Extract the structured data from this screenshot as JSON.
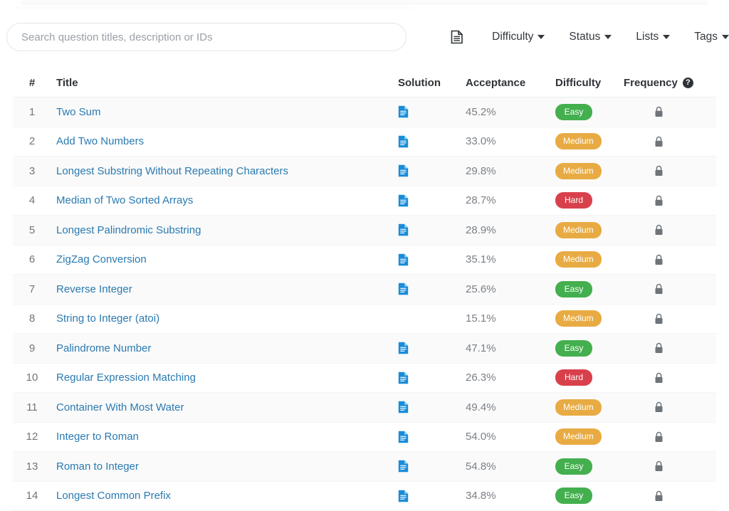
{
  "search": {
    "placeholder": "Search question titles, description or IDs",
    "value": ""
  },
  "toolbar": {
    "doc_icon": "document-icon",
    "filters": [
      {
        "label": "Difficulty"
      },
      {
        "label": "Status"
      },
      {
        "label": "Lists"
      },
      {
        "label": "Tags"
      }
    ]
  },
  "table": {
    "columns": {
      "number": "#",
      "title": "Title",
      "solution": "Solution",
      "acceptance": "Acceptance",
      "difficulty": "Difficulty",
      "frequency": "Frequency",
      "frequency_help": "?"
    },
    "colors": {
      "easy": "#43af4e",
      "medium": "#e8ab43",
      "hard": "#d8414c",
      "link": "#2a7ab0",
      "solution_icon": "#1a8cd8",
      "lock_icon": "#6f7479"
    },
    "rows": [
      {
        "number": "1",
        "title": "Two Sum",
        "has_solution": true,
        "acceptance": "45.2%",
        "difficulty": "Easy",
        "locked": true
      },
      {
        "number": "2",
        "title": "Add Two Numbers",
        "has_solution": true,
        "acceptance": "33.0%",
        "difficulty": "Medium",
        "locked": true
      },
      {
        "number": "3",
        "title": "Longest Substring Without Repeating Characters",
        "has_solution": true,
        "acceptance": "29.8%",
        "difficulty": "Medium",
        "locked": true
      },
      {
        "number": "4",
        "title": "Median of Two Sorted Arrays",
        "has_solution": true,
        "acceptance": "28.7%",
        "difficulty": "Hard",
        "locked": true
      },
      {
        "number": "5",
        "title": "Longest Palindromic Substring",
        "has_solution": true,
        "acceptance": "28.9%",
        "difficulty": "Medium",
        "locked": true
      },
      {
        "number": "6",
        "title": "ZigZag Conversion",
        "has_solution": true,
        "acceptance": "35.1%",
        "difficulty": "Medium",
        "locked": true
      },
      {
        "number": "7",
        "title": "Reverse Integer",
        "has_solution": true,
        "acceptance": "25.6%",
        "difficulty": "Easy",
        "locked": true
      },
      {
        "number": "8",
        "title": "String to Integer (atoi)",
        "has_solution": false,
        "acceptance": "15.1%",
        "difficulty": "Medium",
        "locked": true
      },
      {
        "number": "9",
        "title": "Palindrome Number",
        "has_solution": true,
        "acceptance": "47.1%",
        "difficulty": "Easy",
        "locked": true
      },
      {
        "number": "10",
        "title": "Regular Expression Matching",
        "has_solution": true,
        "acceptance": "26.3%",
        "difficulty": "Hard",
        "locked": true
      },
      {
        "number": "11",
        "title": "Container With Most Water",
        "has_solution": true,
        "acceptance": "49.4%",
        "difficulty": "Medium",
        "locked": true
      },
      {
        "number": "12",
        "title": "Integer to Roman",
        "has_solution": true,
        "acceptance": "54.0%",
        "difficulty": "Medium",
        "locked": true
      },
      {
        "number": "13",
        "title": "Roman to Integer",
        "has_solution": true,
        "acceptance": "54.8%",
        "difficulty": "Easy",
        "locked": true
      },
      {
        "number": "14",
        "title": "Longest Common Prefix",
        "has_solution": true,
        "acceptance": "34.8%",
        "difficulty": "Easy",
        "locked": true
      }
    ]
  }
}
